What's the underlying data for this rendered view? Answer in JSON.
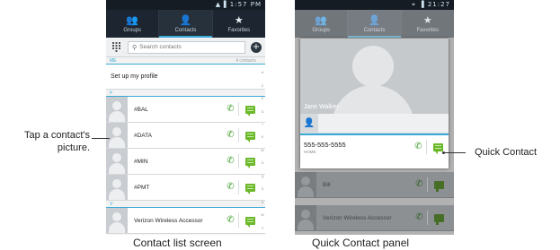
{
  "left_phone": {
    "status": {
      "time": "1:57 PM"
    },
    "tabs": [
      {
        "label": "Groups",
        "icon": "groups-icon"
      },
      {
        "label": "Contacts",
        "icon": "contacts-icon"
      },
      {
        "label": "Favorites",
        "icon": "star-icon"
      }
    ],
    "search": {
      "placeholder": "Search contacts"
    },
    "section_me": {
      "label": "ME",
      "count": "4 contacts"
    },
    "profile_label": "Set up my profile",
    "section_hash": {
      "label": "#"
    },
    "contacts": [
      {
        "name": "#BAL"
      },
      {
        "name": "#DATA"
      },
      {
        "name": "#MIN"
      },
      {
        "name": "#PMT"
      }
    ],
    "section_v": {
      "label": "V"
    },
    "last_contact": {
      "name": "Verizon Wireless Accessor"
    }
  },
  "right_phone": {
    "status": {
      "time": "21:27"
    },
    "tabs": [
      {
        "label": "Groups",
        "icon": "groups-icon"
      },
      {
        "label": "Contacts",
        "icon": "contacts-icon"
      },
      {
        "label": "Favorites",
        "icon": "star-icon"
      }
    ],
    "quick_contact": {
      "name": "Jane Walker",
      "number": "555-555-5555",
      "number_type": "HOME"
    },
    "bg_contacts": [
      {
        "name": "Bill"
      },
      {
        "name": "Verizon Wireless Accessor"
      }
    ]
  },
  "callouts": {
    "left": "Tap a contact's picture.",
    "right": "Quick Contact"
  },
  "captions": {
    "left": "Contact list screen",
    "right": "Quick Contact panel"
  },
  "colors": {
    "accent": "#3aa9d8",
    "call_green": "#3f9d2a",
    "message_green": "#6bb82b",
    "header_dark": "#1d2630"
  }
}
